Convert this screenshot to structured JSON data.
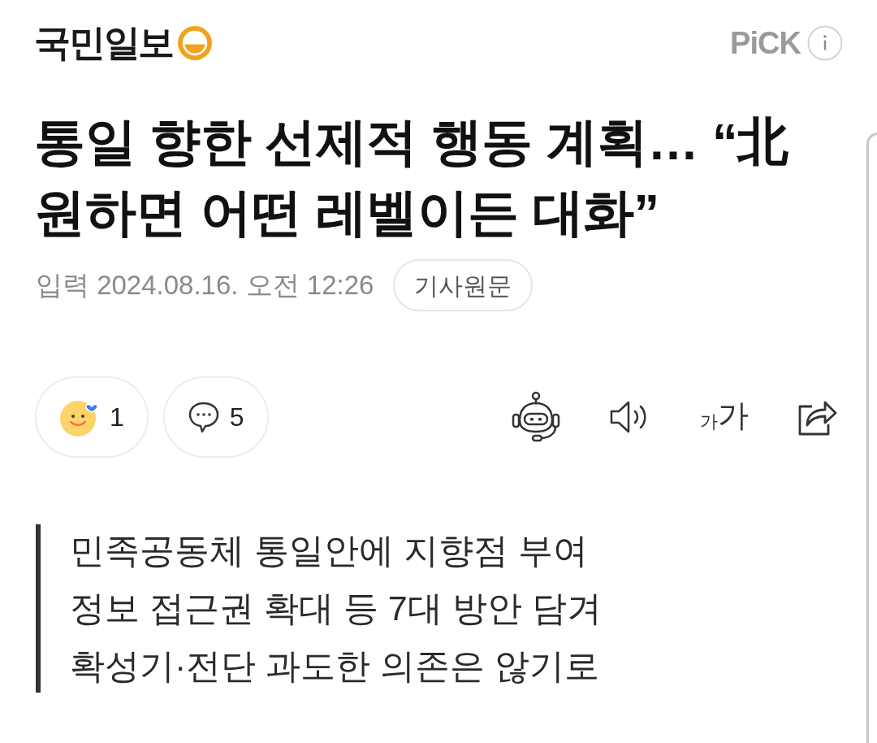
{
  "header": {
    "logo": "국민일보",
    "pick": "PiCK"
  },
  "article": {
    "title": "통일 향한 선제적 행동 계획… “北 원하면 어떤 레벨이든 대화”",
    "date": "입력 2024.08.16. 오전 12:26",
    "original_link": "기사원문"
  },
  "reactions": [
    {
      "kind": "emotion",
      "count": "1"
    },
    {
      "kind": "comment",
      "count": "5"
    }
  ],
  "tools": [
    {
      "kind": "summary-bot"
    },
    {
      "kind": "tts"
    },
    {
      "kind": "font-size",
      "small": "가",
      "large": "가"
    },
    {
      "kind": "share"
    }
  ],
  "summary": [
    "민족공동체 통일안에 지향점 부여",
    "정보 접근권 확대 등 7대 방안 담겨",
    "확성기·전단 과도한 의존은 않기로"
  ]
}
